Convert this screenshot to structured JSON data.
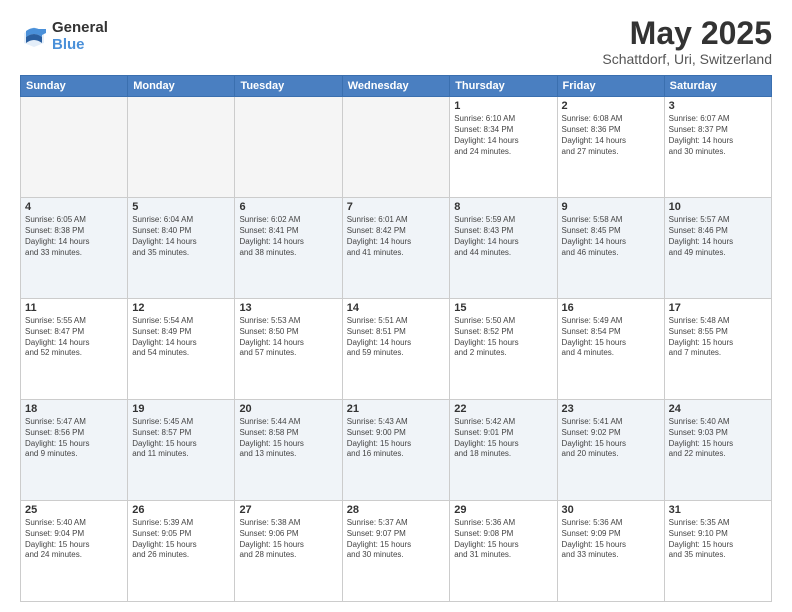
{
  "logo": {
    "general": "General",
    "blue": "Blue"
  },
  "title": "May 2025",
  "subtitle": "Schattdorf, Uri, Switzerland",
  "days_header": [
    "Sunday",
    "Monday",
    "Tuesday",
    "Wednesday",
    "Thursday",
    "Friday",
    "Saturday"
  ],
  "weeks": [
    [
      {
        "num": "",
        "info": ""
      },
      {
        "num": "",
        "info": ""
      },
      {
        "num": "",
        "info": ""
      },
      {
        "num": "",
        "info": ""
      },
      {
        "num": "1",
        "info": "Sunrise: 6:10 AM\nSunset: 8:34 PM\nDaylight: 14 hours\nand 24 minutes."
      },
      {
        "num": "2",
        "info": "Sunrise: 6:08 AM\nSunset: 8:36 PM\nDaylight: 14 hours\nand 27 minutes."
      },
      {
        "num": "3",
        "info": "Sunrise: 6:07 AM\nSunset: 8:37 PM\nDaylight: 14 hours\nand 30 minutes."
      }
    ],
    [
      {
        "num": "4",
        "info": "Sunrise: 6:05 AM\nSunset: 8:38 PM\nDaylight: 14 hours\nand 33 minutes."
      },
      {
        "num": "5",
        "info": "Sunrise: 6:04 AM\nSunset: 8:40 PM\nDaylight: 14 hours\nand 35 minutes."
      },
      {
        "num": "6",
        "info": "Sunrise: 6:02 AM\nSunset: 8:41 PM\nDaylight: 14 hours\nand 38 minutes."
      },
      {
        "num": "7",
        "info": "Sunrise: 6:01 AM\nSunset: 8:42 PM\nDaylight: 14 hours\nand 41 minutes."
      },
      {
        "num": "8",
        "info": "Sunrise: 5:59 AM\nSunset: 8:43 PM\nDaylight: 14 hours\nand 44 minutes."
      },
      {
        "num": "9",
        "info": "Sunrise: 5:58 AM\nSunset: 8:45 PM\nDaylight: 14 hours\nand 46 minutes."
      },
      {
        "num": "10",
        "info": "Sunrise: 5:57 AM\nSunset: 8:46 PM\nDaylight: 14 hours\nand 49 minutes."
      }
    ],
    [
      {
        "num": "11",
        "info": "Sunrise: 5:55 AM\nSunset: 8:47 PM\nDaylight: 14 hours\nand 52 minutes."
      },
      {
        "num": "12",
        "info": "Sunrise: 5:54 AM\nSunset: 8:49 PM\nDaylight: 14 hours\nand 54 minutes."
      },
      {
        "num": "13",
        "info": "Sunrise: 5:53 AM\nSunset: 8:50 PM\nDaylight: 14 hours\nand 57 minutes."
      },
      {
        "num": "14",
        "info": "Sunrise: 5:51 AM\nSunset: 8:51 PM\nDaylight: 14 hours\nand 59 minutes."
      },
      {
        "num": "15",
        "info": "Sunrise: 5:50 AM\nSunset: 8:52 PM\nDaylight: 15 hours\nand 2 minutes."
      },
      {
        "num": "16",
        "info": "Sunrise: 5:49 AM\nSunset: 8:54 PM\nDaylight: 15 hours\nand 4 minutes."
      },
      {
        "num": "17",
        "info": "Sunrise: 5:48 AM\nSunset: 8:55 PM\nDaylight: 15 hours\nand 7 minutes."
      }
    ],
    [
      {
        "num": "18",
        "info": "Sunrise: 5:47 AM\nSunset: 8:56 PM\nDaylight: 15 hours\nand 9 minutes."
      },
      {
        "num": "19",
        "info": "Sunrise: 5:45 AM\nSunset: 8:57 PM\nDaylight: 15 hours\nand 11 minutes."
      },
      {
        "num": "20",
        "info": "Sunrise: 5:44 AM\nSunset: 8:58 PM\nDaylight: 15 hours\nand 13 minutes."
      },
      {
        "num": "21",
        "info": "Sunrise: 5:43 AM\nSunset: 9:00 PM\nDaylight: 15 hours\nand 16 minutes."
      },
      {
        "num": "22",
        "info": "Sunrise: 5:42 AM\nSunset: 9:01 PM\nDaylight: 15 hours\nand 18 minutes."
      },
      {
        "num": "23",
        "info": "Sunrise: 5:41 AM\nSunset: 9:02 PM\nDaylight: 15 hours\nand 20 minutes."
      },
      {
        "num": "24",
        "info": "Sunrise: 5:40 AM\nSunset: 9:03 PM\nDaylight: 15 hours\nand 22 minutes."
      }
    ],
    [
      {
        "num": "25",
        "info": "Sunrise: 5:40 AM\nSunset: 9:04 PM\nDaylight: 15 hours\nand 24 minutes."
      },
      {
        "num": "26",
        "info": "Sunrise: 5:39 AM\nSunset: 9:05 PM\nDaylight: 15 hours\nand 26 minutes."
      },
      {
        "num": "27",
        "info": "Sunrise: 5:38 AM\nSunset: 9:06 PM\nDaylight: 15 hours\nand 28 minutes."
      },
      {
        "num": "28",
        "info": "Sunrise: 5:37 AM\nSunset: 9:07 PM\nDaylight: 15 hours\nand 30 minutes."
      },
      {
        "num": "29",
        "info": "Sunrise: 5:36 AM\nSunset: 9:08 PM\nDaylight: 15 hours\nand 31 minutes."
      },
      {
        "num": "30",
        "info": "Sunrise: 5:36 AM\nSunset: 9:09 PM\nDaylight: 15 hours\nand 33 minutes."
      },
      {
        "num": "31",
        "info": "Sunrise: 5:35 AM\nSunset: 9:10 PM\nDaylight: 15 hours\nand 35 minutes."
      }
    ]
  ]
}
